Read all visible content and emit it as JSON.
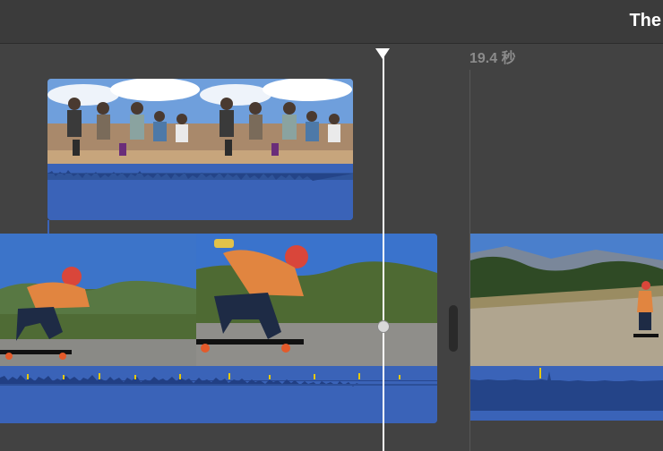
{
  "window": {
    "title": "The"
  },
  "timeline": {
    "time_label": "19.4 秒",
    "playhead_icon": "playhead-triangle-icon"
  },
  "clips": {
    "connected": {
      "kind": "video-with-audio",
      "thumbnails": 2
    },
    "skate": {
      "kind": "video-with-audio",
      "thumbnails": 2
    },
    "road": {
      "kind": "video-with-audio",
      "thumbnails": 1
    }
  },
  "colors": {
    "background": "#424242",
    "audio": "#3a63b8",
    "playhead": "#ffffff",
    "peak": "#e6c800"
  }
}
